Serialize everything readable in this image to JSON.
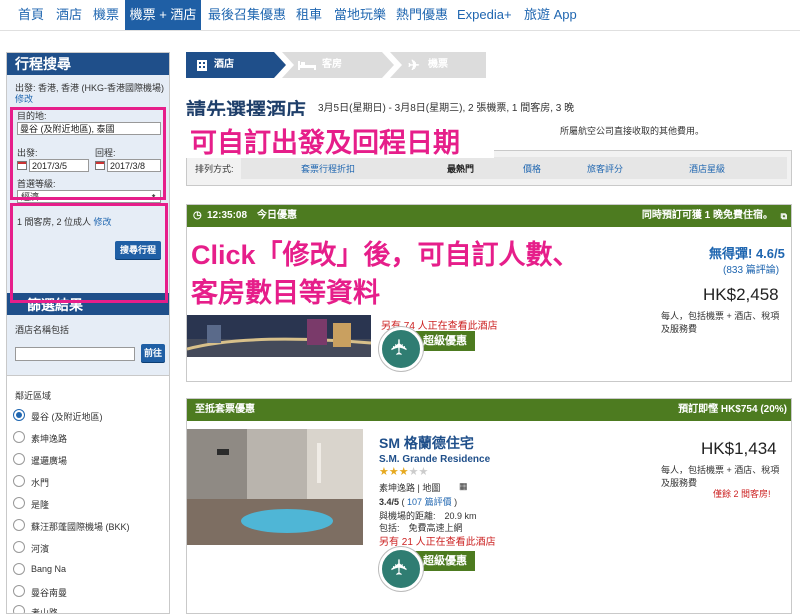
{
  "nav": {
    "items": [
      "首頁",
      "酒店",
      "機票",
      "機票 + 酒店",
      "最後召集優惠",
      "租車",
      "當地玩樂",
      "熱門優惠",
      "Expedia+",
      "旅遊 App"
    ]
  },
  "sidebar": {
    "title": "行程搜尋",
    "origin_label": "出發:",
    "origin_value": "香港, 香港 (HKG-香港國際機場)",
    "origin_change": "修改",
    "dest_label": "目的地:",
    "dest_value": "曼谷 (及附近地區), 泰國",
    "depart_label": "出發:",
    "depart_value": "2017/3/5",
    "return_label": "回程:",
    "return_value": "2017/3/8",
    "class_label": "首選等級:",
    "class_value": "經濟",
    "pax_text": "1 間客房, 2 位成人",
    "pax_change": "修改",
    "search_button": "搜尋行程",
    "filter_title": "篩選結果",
    "hotel_name_label": "酒店名稱包括",
    "hotel_name_placeholder": "",
    "go_button": "前往",
    "area_title": "鄰近區域",
    "areas": [
      "曼谷 (及附近地區)",
      "素坤逸路",
      "暹邏廣場",
      "水門",
      "是隆",
      "蘇汪那蓬國際機場 (BKK)",
      "河濱",
      "Bang Na",
      "曼谷南曼",
      "考山路"
    ]
  },
  "steps": [
    "酒店",
    "客房",
    "機票"
  ],
  "main": {
    "title": "請先選擇酒店",
    "subtitle": "3月5日(星期日) - 3月8日(星期三), 2 張機票, 1 間客房, 3 晚",
    "note": "所屬航空公司直接收取的其他費用。",
    "sort_label": "排列方式:",
    "sort_options": [
      "套票行程折扣",
      "最熱門",
      "價格",
      "旅客評分",
      "酒店星級"
    ]
  },
  "overlay": {
    "date_note": "可自訂出發及回程日期",
    "pax_note_line1": "Click「修改」後，可自訂人數、",
    "pax_note_line2": "客房數目等資料"
  },
  "cards": [
    {
      "head_left": "12:35:08　今日優惠",
      "head_right": "同時預訂可獲 1 晚免費住宿。",
      "rating_text": "無得彈! 4.6/5",
      "reviews": "(833 篇評論)",
      "price": "HK$2,458",
      "price_note": "每人，包括機票 + 酒店、稅項及服務費",
      "viewing": "另有 74 人正在查看此酒店",
      "badge": "超級優惠"
    },
    {
      "head_left": "至抵套票優惠",
      "head_right": "預訂即慳 HK$754 (20%)",
      "name": "SM 格蘭德住宅",
      "name_en": "S.M. Grande Residence",
      "location": "素坤逸路 | 地圖",
      "rating": "3.4/5",
      "reviews_link": "107 篇評價",
      "distance": "與機場的距離:　20.9 km",
      "amenity": "包括:　免費高速上網",
      "viewing": "另有 21 人正在查看此酒店",
      "badge": "超級優惠",
      "price": "HK$1,434",
      "price_note": "每人，包括機票 + 酒店、稅項及服務費",
      "rooms_left": "僅餘 2 間客房!"
    }
  ],
  "colors": {
    "nav_active": "#1f5fa5",
    "accent_pink": "#e61e8a",
    "card_green": "#4d7b20",
    "link_blue": "#1f66b0"
  }
}
